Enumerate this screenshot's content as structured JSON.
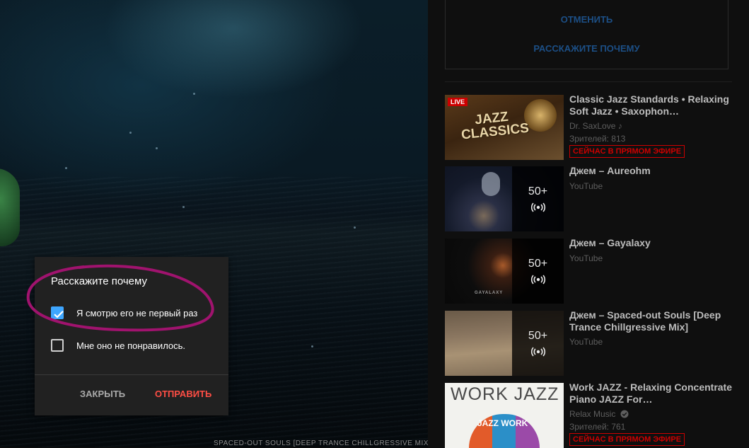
{
  "player": {
    "caption": "SPACED-OUT SOULS [DEEP TRANCE CHILLGRESSIVE MIX]"
  },
  "dialog": {
    "title": "Расскажите почему",
    "options": [
      {
        "label": "Я смотрю его не первый раз",
        "checked": true
      },
      {
        "label": "Мне оно не понравилось.",
        "checked": false
      }
    ],
    "close_label": "ЗАКРЫТЬ",
    "submit_label": "ОТПРАВИТЬ"
  },
  "feedback": {
    "undo_label": "ОТМЕНИТЬ",
    "tell_why_label": "РАССКАЖИТЕ ПОЧЕМУ"
  },
  "videos": [
    {
      "title": "Classic Jazz Standards • Relaxing Soft Jazz • Saxophon…",
      "channel": "Dr. SaxLove ♪",
      "viewers": "Зрителей: 813",
      "live_badge": "LIVE",
      "live_tag": "СЕЙЧАС В ПРЯМОМ ЭФИРЕ",
      "thumb_text": "JAZZ CLASSICS"
    },
    {
      "title": "Джем – Aureohm",
      "channel": "YouTube",
      "mix_count": "50+"
    },
    {
      "title": "Джем – Gayalaxy",
      "channel": "YouTube",
      "mix_count": "50+",
      "thumb_text": "GAYALAXY"
    },
    {
      "title": "Джем – Spaced-out Souls [Deep Trance Chillgressive Mix]",
      "channel": "YouTube",
      "mix_count": "50+"
    },
    {
      "title": "Work JAZZ - Relaxing Concentrate Piano JAZZ For…",
      "channel": "Relax Music",
      "viewers": "Зрителей: 761",
      "live_tag": "СЕЙЧАС В ПРЯМОМ ЭФИРЕ",
      "thumb_text": "WORK JAZZ",
      "thumb_subtext": "JAZZ  WORK"
    }
  ],
  "colors": {
    "accent_blue": "#3ea6ff",
    "submit_red": "#ff4e45",
    "live_red": "#cc0000",
    "annotation_magenta": "#a0136e"
  }
}
